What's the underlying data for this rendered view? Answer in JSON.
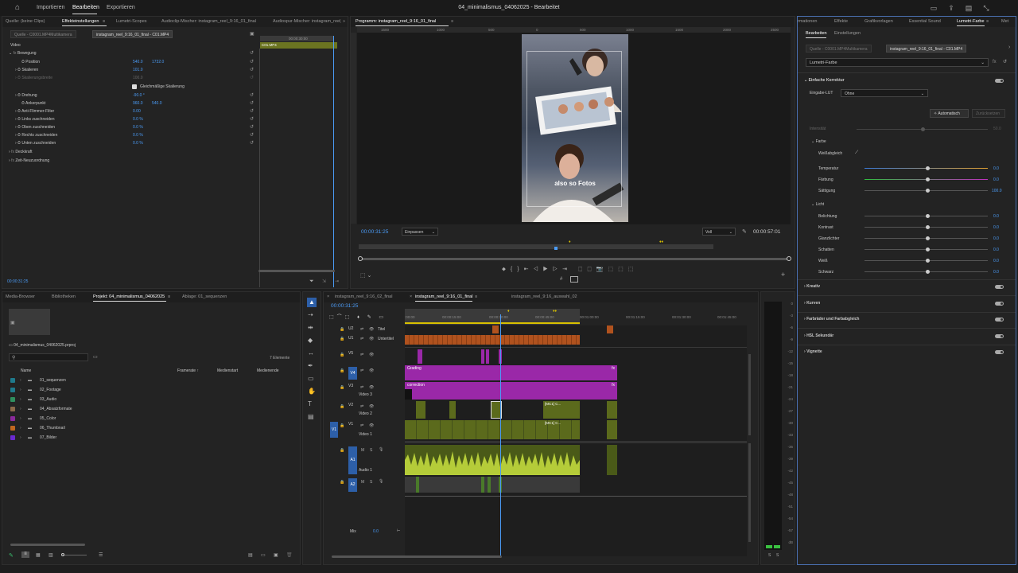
{
  "topbar": {
    "home_icon": "home-icon",
    "menus": [
      "Importieren",
      "Bearbeiten",
      "Exportieren"
    ],
    "title": "04_minimalismus_04062025 - Bearbeitet"
  },
  "effects": {
    "tabs": [
      "Quelle: (keine Clips)",
      "Effekteinstellungen",
      "Lumetri-Scopes",
      "Audioclip-Mischer: instagram_reel_9:16_01_final",
      "Audiospur-Mischer: instagram_reel_9:16_01_final"
    ],
    "source_tabs": [
      "Quelle - C0001.MP4Multikamera",
      "instagram_reel_9:16_01_final - C01.MP4"
    ],
    "video_label": "Video",
    "timecode_top": "00:00:30:00",
    "clip_label": "C01.MP4",
    "rows": [
      {
        "name": "Bewegung",
        "vals": []
      },
      {
        "name": "Position",
        "vals": [
          "540.0",
          "1732.0"
        ]
      },
      {
        "name": "Skalieren",
        "vals": [
          "101.0"
        ]
      },
      {
        "name": "Skalierungsbreite",
        "vals": [
          "100.0"
        ]
      },
      {
        "name": "Gleichmäßige Skalierung",
        "vals": []
      },
      {
        "name": "Drehung",
        "vals": [
          "-90.0 °"
        ]
      },
      {
        "name": "Ankerpunkt",
        "vals": [
          "960.0",
          "540.0"
        ]
      },
      {
        "name": "Anti-Flimmer-Filter",
        "vals": [
          "0.00"
        ]
      },
      {
        "name": "Links zuschneiden",
        "vals": [
          "0.0 %"
        ]
      },
      {
        "name": "Oben zuschneiden",
        "vals": [
          "0.0 %"
        ]
      },
      {
        "name": "Rechts zuschneiden",
        "vals": [
          "0.0 %"
        ]
      },
      {
        "name": "Unten zuschneiden",
        "vals": [
          "0.0 %"
        ]
      },
      {
        "name": "Deckkraft",
        "vals": []
      },
      {
        "name": "Zeit-Neuzuordnung",
        "vals": []
      }
    ],
    "timecode_bottom": "00:00:31:25"
  },
  "program": {
    "tab": "Programm: instagram_reel_9:16_01_final",
    "ruler": [
      "1500",
      "1000",
      "500",
      "0",
      "500",
      "1000",
      "1500",
      "2000",
      "2500"
    ],
    "subtitle": "also so Fotos",
    "timecode_left": "00:00:31:25",
    "fit": "Einpassen",
    "quality": "Voll",
    "timecode_right": "00:00:57:01"
  },
  "project": {
    "tabs": [
      "Media-Browser",
      "Bibliotheken",
      "Projekt: 04_minimalismus_04062025",
      "Ablage: 01_sequenzen"
    ],
    "file": "04_minimalismus_04062025.prproj",
    "count": "7 Elemente",
    "cols": [
      "Name",
      "Framerate",
      "Medienstart",
      "Medienende"
    ],
    "folders": [
      {
        "name": "01_sequenzen",
        "color": "#1f7a8c"
      },
      {
        "name": "02_Footage",
        "color": "#1f7a8c"
      },
      {
        "name": "03_Audio",
        "color": "#2f8f5f"
      },
      {
        "name": "04_Absatzformate",
        "color": "#8a6a4a"
      },
      {
        "name": "05_Color",
        "color": "#8a2a9a"
      },
      {
        "name": "06_Thumbnail",
        "color": "#c06820"
      },
      {
        "name": "07_Bilder",
        "color": "#6a2ad0"
      }
    ]
  },
  "timeline": {
    "tabs": [
      "instagram_reel_9:16_02_final",
      "instagram_reel_9:16_01_final",
      "instagram_reel_9:16_auswahl_02"
    ],
    "timecode": "00:00:31:25",
    "ruler": [
      ":00:00",
      "00:00:15:00",
      "00:00:30:00",
      "00:00:45:00",
      "00:01:00:00",
      "00:01:15:00",
      "00:01:30:00",
      "00:01:45:00"
    ],
    "tracks": [
      {
        "id": "U2",
        "name": "Titel"
      },
      {
        "id": "U1",
        "name": "Untertitel"
      },
      {
        "id": "V5",
        "name": ""
      },
      {
        "id": "V4",
        "name": ""
      },
      {
        "id": "V3",
        "name": "Video 3"
      },
      {
        "id": "V2",
        "name": "Video 2"
      },
      {
        "id": "V1",
        "name": "Video 1"
      },
      {
        "id": "A1",
        "name": "Audio 1"
      },
      {
        "id": "A2",
        "name": ""
      }
    ],
    "mix_label": "Mix",
    "mix_value": "0.0",
    "clip_grading": "Grading",
    "clip_correction": "correction",
    "clip_mc1": "[MC1] C...",
    "clip_mc2": "[MC1] C..."
  },
  "meter": {
    "labels": [
      "0",
      "-3",
      "-6",
      "-9",
      "-12",
      "-15",
      "-18",
      "-21",
      "-24",
      "-27",
      "-30",
      "-33",
      "-36",
      "-39",
      "-42",
      "-45",
      "-48",
      "-51",
      "-54",
      "-57",
      "dB"
    ],
    "ss": [
      "S",
      "S"
    ]
  },
  "lumetri": {
    "tabs": [
      "rmationen",
      "Effekte",
      "Grafikvorlagen",
      "Essential Sound",
      "Lumetri-Farbe",
      "Met"
    ],
    "subtabs": [
      "Bearbeiten",
      "Einstellungen"
    ],
    "source_tabs": [
      "Quelle - C0001.MP4Multikamera",
      "instagram_reel_9:16_01_final - C01.MP4"
    ],
    "effect": "Lumetri-Farbe",
    "basic": "Einfache Korrektur",
    "lut_label": "Eingabe-LUT",
    "lut_value": "Ohne",
    "auto": "Automatisch",
    "reset": "Zurücksetzen",
    "intensity": "Intensität",
    "intensity_val": "50.0",
    "color_section": "Farbe",
    "wb": "Weißabgleich",
    "color_rows": [
      {
        "name": "Temperatur",
        "val": "0.0"
      },
      {
        "name": "Färbung",
        "val": "0.0"
      },
      {
        "name": "Sättigung",
        "val": "100.0"
      }
    ],
    "light_section": "Licht",
    "light_rows": [
      {
        "name": "Belichtung",
        "val": "0.0"
      },
      {
        "name": "Kontrast",
        "val": "0.0"
      },
      {
        "name": "Glanzlichter",
        "val": "0.0"
      },
      {
        "name": "Schatten",
        "val": "0.0"
      },
      {
        "name": "Weiß",
        "val": "0.0"
      },
      {
        "name": "Schwarz",
        "val": "0.0"
      }
    ],
    "sections": [
      "Kreativ",
      "Kurven",
      "Farbräder und Farbabgleich",
      "HSL Sekundär",
      "Vignette"
    ]
  }
}
